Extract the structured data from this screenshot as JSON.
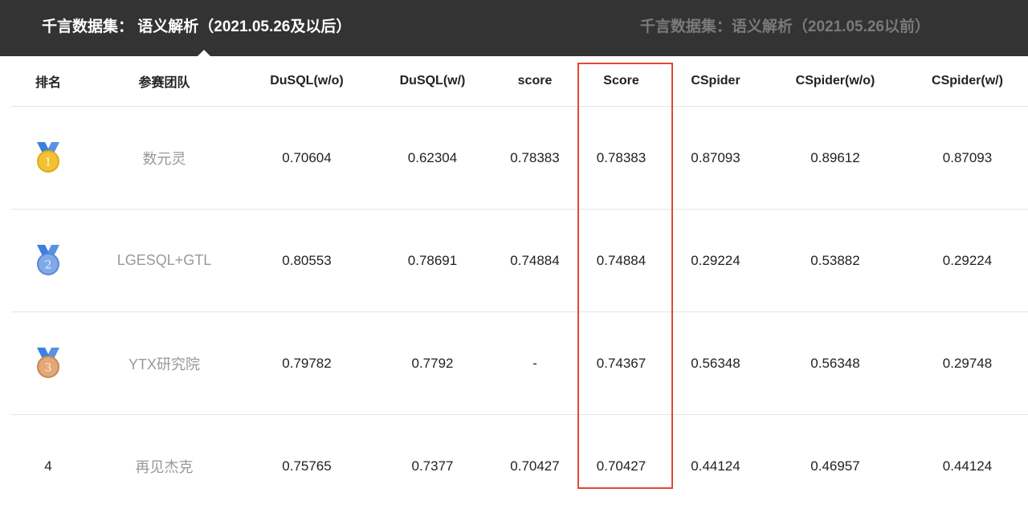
{
  "tabs": [
    {
      "label": "千言数据集：  语义解析（2021.05.26及以后）",
      "active": true
    },
    {
      "label": "千言数据集：语义解析（2021.05.26以前）",
      "active": false
    }
  ],
  "table": {
    "headers": [
      "排名",
      "参赛团队",
      "DuSQL(w/o)",
      "DuSQL(w/)",
      "score",
      "Score",
      "CSpider",
      "CSpider(w/o)",
      "CSpider(w/)"
    ],
    "rows": [
      {
        "rank": "1",
        "medal": "gold",
        "cells": [
          "数元灵",
          "0.70604",
          "0.62304",
          "0.78383",
          "0.78383",
          "0.87093",
          "0.89612",
          "0.87093"
        ]
      },
      {
        "rank": "2",
        "medal": "silver",
        "cells": [
          "LGESQL+GTL",
          "0.80553",
          "0.78691",
          "0.74884",
          "0.74884",
          "0.29224",
          "0.53882",
          "0.29224"
        ]
      },
      {
        "rank": "3",
        "medal": "bronze",
        "cells": [
          "YTX研究院",
          "0.79782",
          "0.7792",
          "-",
          "0.74367",
          "0.56348",
          "0.56348",
          "0.29748"
        ]
      },
      {
        "rank": "4",
        "medal": "",
        "cells": [
          "再见杰克",
          "0.75765",
          "0.7377",
          "0.70427",
          "0.70427",
          "0.44124",
          "0.46957",
          "0.44124"
        ]
      }
    ]
  },
  "medals": {
    "gold": {
      "ribbon": "#3b7fe0",
      "face": "#f1c232",
      "rim": "#dfa91d",
      "text": "#fff6cf"
    },
    "silver": {
      "ribbon": "#3b7fe0",
      "face": "#7fa9e8",
      "rim": "#5b88d6",
      "text": "#e6efff"
    },
    "bronze": {
      "ribbon": "#3b7fe0",
      "face": "#e3a877",
      "rim": "#c88653",
      "text": "#fdebd9"
    }
  },
  "highlight_color": "#e04a35"
}
